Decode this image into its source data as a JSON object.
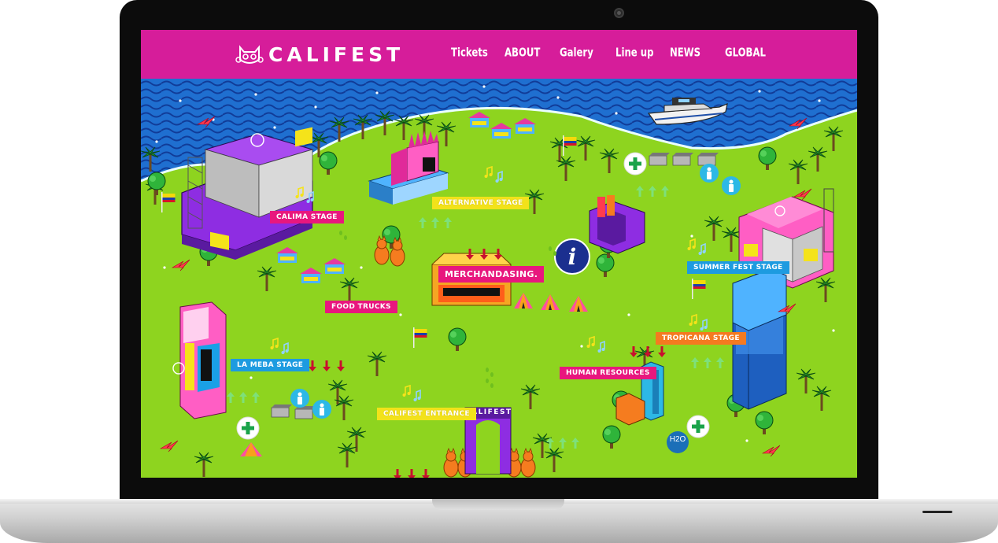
{
  "site": {
    "brand": "CALIFEST",
    "nav": [
      {
        "label": "Tickets"
      },
      {
        "label": "ABOUT"
      },
      {
        "label": "Galery"
      },
      {
        "label": "Line up"
      },
      {
        "label": "NEWS"
      },
      {
        "label": "GLOBAL"
      }
    ]
  },
  "map": {
    "labels": {
      "calima": "CALIMA STAGE",
      "alternative": "ALTERNATIVE STAGE",
      "summer": "SUMMER FEST STAGE",
      "merch": "MERCHANDASING.",
      "food": "FOOD TRUCKS",
      "tropicana": "TROPICANA STAGE",
      "lameba": "LA MEBA STAGE",
      "hr": "HUMAN RESOURCES",
      "entrance": "CALIFEST ENTRANCE",
      "gate": "CALIFEST",
      "h2o": "H2O",
      "info": "i"
    }
  },
  "colors": {
    "nav_bg": "#d61d9a",
    "grass": "#8ed41f",
    "sea": "#1f6fd0",
    "stage_purple": "#8a2be2",
    "stage_pink": "#ff5ec4"
  }
}
